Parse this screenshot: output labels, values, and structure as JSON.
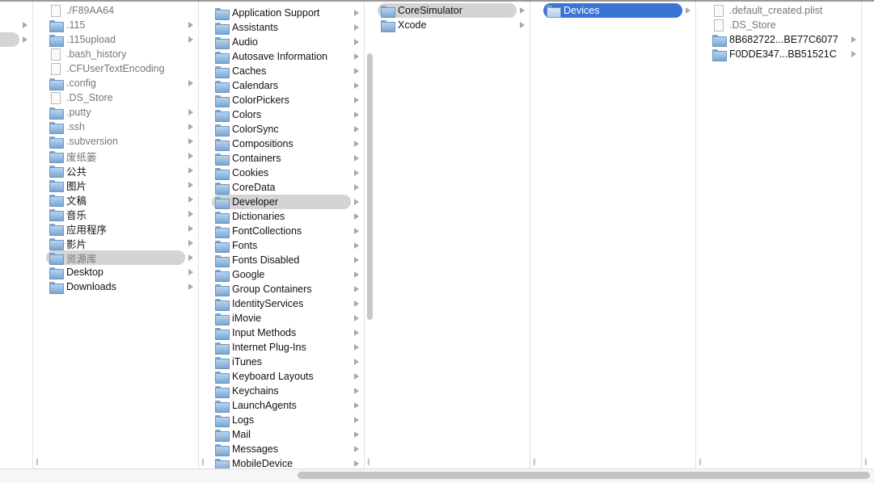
{
  "columns": [
    {
      "rows": [
        {
          "label": "",
          "arrow": true
        },
        {
          "label": "",
          "arrow": true,
          "selected": "gray"
        }
      ]
    },
    {
      "rows": [
        {
          "label": "./F89AA64",
          "type": "file",
          "dim": true
        },
        {
          "label": ".115",
          "type": "folder",
          "arrow": true,
          "dim": true
        },
        {
          "label": ".115upload",
          "type": "folder",
          "arrow": true,
          "dim": true
        },
        {
          "label": ".bash_history",
          "type": "file",
          "dim": true
        },
        {
          "label": ".CFUserTextEncoding",
          "type": "file",
          "dim": true
        },
        {
          "label": ".config",
          "type": "folder",
          "arrow": true,
          "dim": true
        },
        {
          "label": ".DS_Store",
          "type": "file",
          "dim": true
        },
        {
          "label": ".putty",
          "type": "folder",
          "arrow": true,
          "dim": true
        },
        {
          "label": ".ssh",
          "type": "folder",
          "arrow": true,
          "dim": true
        },
        {
          "label": ".subversion",
          "type": "folder",
          "arrow": true,
          "dim": true
        },
        {
          "label": "废纸篓",
          "type": "folder",
          "arrow": true,
          "dim": true
        },
        {
          "label": "公共",
          "type": "folder",
          "arrow": true
        },
        {
          "label": "图片",
          "type": "folder",
          "arrow": true
        },
        {
          "label": "文稿",
          "type": "folder",
          "arrow": true
        },
        {
          "label": "音乐",
          "type": "folder",
          "arrow": true
        },
        {
          "label": "应用程序",
          "type": "folder",
          "arrow": true
        },
        {
          "label": "影片",
          "type": "folder",
          "arrow": true
        },
        {
          "label": "资源库",
          "type": "folder",
          "arrow": true,
          "selected": "gray",
          "dim": true
        },
        {
          "label": "Desktop",
          "type": "folder",
          "arrow": true
        },
        {
          "label": "Downloads",
          "type": "folder",
          "arrow": true
        }
      ]
    },
    {
      "rows": [
        {
          "label": "Application Support",
          "type": "folder",
          "arrow": true
        },
        {
          "label": "Assistants",
          "type": "folder",
          "arrow": true
        },
        {
          "label": "Audio",
          "type": "folder",
          "arrow": true
        },
        {
          "label": "Autosave Information",
          "type": "folder",
          "arrow": true
        },
        {
          "label": "Caches",
          "type": "folder",
          "arrow": true
        },
        {
          "label": "Calendars",
          "type": "folder",
          "arrow": true
        },
        {
          "label": "ColorPickers",
          "type": "folder",
          "arrow": true
        },
        {
          "label": "Colors",
          "type": "folder",
          "arrow": true
        },
        {
          "label": "ColorSync",
          "type": "folder",
          "arrow": true
        },
        {
          "label": "Compositions",
          "type": "folder",
          "arrow": true
        },
        {
          "label": "Containers",
          "type": "folder",
          "arrow": true
        },
        {
          "label": "Cookies",
          "type": "folder",
          "arrow": true
        },
        {
          "label": "CoreData",
          "type": "folder",
          "arrow": true
        },
        {
          "label": "Developer",
          "type": "folder",
          "arrow": true,
          "selected": "gray"
        },
        {
          "label": "Dictionaries",
          "type": "folder",
          "arrow": true
        },
        {
          "label": "FontCollections",
          "type": "folder",
          "arrow": true
        },
        {
          "label": "Fonts",
          "type": "folder",
          "arrow": true
        },
        {
          "label": "Fonts Disabled",
          "type": "folder",
          "arrow": true
        },
        {
          "label": "Google",
          "type": "folder",
          "arrow": true
        },
        {
          "label": "Group Containers",
          "type": "folder",
          "arrow": true
        },
        {
          "label": "IdentityServices",
          "type": "folder",
          "arrow": true
        },
        {
          "label": "iMovie",
          "type": "folder",
          "arrow": true
        },
        {
          "label": "Input Methods",
          "type": "folder",
          "arrow": true
        },
        {
          "label": "Internet Plug-Ins",
          "type": "folder",
          "arrow": true
        },
        {
          "label": "iTunes",
          "type": "folder",
          "arrow": true
        },
        {
          "label": "Keyboard Layouts",
          "type": "folder",
          "arrow": true
        },
        {
          "label": "Keychains",
          "type": "folder",
          "arrow": true
        },
        {
          "label": "LaunchAgents",
          "type": "folder",
          "arrow": true
        },
        {
          "label": "Logs",
          "type": "folder",
          "arrow": true
        },
        {
          "label": "Mail",
          "type": "folder",
          "arrow": true
        },
        {
          "label": "Messages",
          "type": "folder",
          "arrow": true
        },
        {
          "label": "MobileDevice",
          "type": "folder",
          "arrow": true
        }
      ]
    },
    {
      "rows": [
        {
          "label": "CoreSimulator",
          "type": "folder",
          "arrow": true,
          "selected": "gray"
        },
        {
          "label": "Xcode",
          "type": "folder",
          "arrow": true
        }
      ]
    },
    {
      "rows": [
        {
          "label": "Devices",
          "type": "folder",
          "arrow": true,
          "selected": "blue"
        }
      ]
    },
    {
      "rows": [
        {
          "label": ".default_created.plist",
          "type": "file",
          "dim": true
        },
        {
          "label": ".DS_Store",
          "type": "file",
          "dim": true
        },
        {
          "label": "8B682722...BE77C6077",
          "type": "folder",
          "arrow": true
        },
        {
          "label": "F0DDE347...BB51521C",
          "type": "folder",
          "arrow": true
        }
      ]
    }
  ],
  "colors": {
    "selection_blue": "#3a75d6",
    "selection_gray": "#d4d4d4"
  }
}
